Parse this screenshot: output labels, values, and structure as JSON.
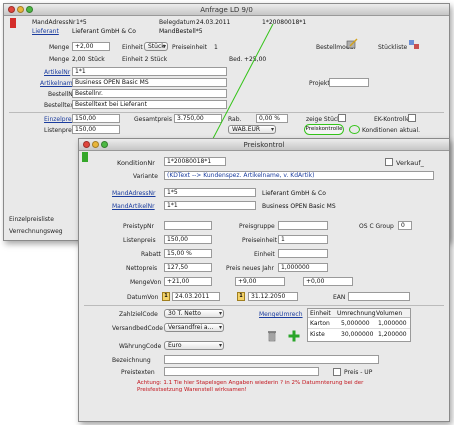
{
  "back": {
    "title": "Anfrage LD   9/0",
    "mandadresse_label": "MandAdressNr",
    "mandadresse_value": "1*5",
    "belegdatum_label": "Belegdatum",
    "belegdatum_value": "24.03.2011",
    "beleg_nr": "1*20080018*1",
    "lieferant_label": "Lieferant",
    "lieferant_value": "Lieferant GmbH & Co",
    "mandbestell": "MandBestell*5",
    "menge_label": "Menge",
    "menge_value": "+2,00",
    "einheit_label": "Einheit",
    "einheit_value": "Stück",
    "preiseinheit_label": "Preiseinheit",
    "preiseinheit_value": "1",
    "bestellmodul": "Bestellmodul",
    "stueckliste": "Stückliste",
    "menge2_label": "Menge",
    "menge2_value": "2,00",
    "menge2_unit": "Stück",
    "einheit2_label": "Einheit 2 Stück",
    "bedarf_label": "Bed.",
    "bedarf_value": "+25,00",
    "artikelnr_label": "ArtikelNr",
    "artikelnr_value": "1*1",
    "artikelname_label": "Artikelname",
    "artikelname_value": "Business OPEN Basic MS",
    "bestellnr_label": "BestellNr",
    "bestellnr_value": "Bestellnr.",
    "projekt_label": "Projekt",
    "bestelltext_label": "Bestelltext",
    "bestelltext_value": "Bestelltext bei Lieferant",
    "einzelpreis_label": "Einzelpreis",
    "einzelpreis_value": "150,00",
    "gesamtpreis_label": "Gesamtpreis",
    "gesamtpreis_value": "3.750,00",
    "rabatt_label": "Rab.",
    "rabatt_value": "0,00 %",
    "zeige_stueckliste": "zeige Stückl.",
    "ek_kontrolle": "EK-Kontrolle",
    "listenpreis_label": "Listenpreis",
    "listenpreis_value": "150,00",
    "waehrung_value": "WAB.EUR",
    "preiskontrolle_btn": "Preiskontrolle",
    "konditionen_btn": "Konditionen aktual.",
    "left1": "Einzelpreisliste",
    "left2": "Verrechnungsweg"
  },
  "front": {
    "title": "Preiskontrol",
    "konditionnr_label": "KonditionNr",
    "konditionnr_value": "1*20080018*1",
    "verkauf_label": "Verkauf_",
    "variante_label": "Variante",
    "variante_value": "(KDText --> Kundenspez. Artikelname, v. KdArtik)",
    "mandadressnr_label": "MandAdressNr",
    "mandadressnr_value": "1*5",
    "lieferant_value": "Lieferant GmbH & Co",
    "mandartikelnr_label": "MandArtikelNr",
    "mandartikelnr_value": "1*1",
    "artikel_value": "Business OPEN Basic MS",
    "preistypnr_label": "PreistypNr",
    "preisgruppe_label": "Preisgruppe",
    "osc_label": "OS C Group",
    "osc_value": "0",
    "listenpreis_label": "Listenpreis",
    "listenpreis_value": "150,00",
    "preiseinheit_label": "Preiseinheit",
    "preiseinheit_value": "1",
    "rabatt_label": "Rabatt",
    "rabatt_value": "15,00 %",
    "einheit_label": "Einheit",
    "nettopreis_label": "Nettopreis",
    "nettopreis_value": "127,50",
    "preis_neues_jahr_label": "Preis neues Jahr",
    "preis_neues_jahr_value": "1,000000",
    "mengevon_label": "MengeVon",
    "mengevon_value": "+21,00",
    "mengebis_value": "+9,00",
    "mengebis2_value": "+0,00",
    "datumvon_label": "DatumVon",
    "datumvon_value": "24.03.2011",
    "datumbis_value": "31.12.2050",
    "ean_label": "EAN",
    "zahlziel_label": "ZahlzielCode",
    "zahlziel_value": "30 T. Netto",
    "versand_label": "VersandbedCode",
    "versand_value": "Versandfrei a...",
    "waehrung_label": "WährungCode",
    "waehrung_value": "Euro",
    "mengeumrech_label": "MengeUmrech",
    "umrech_headers": [
      "Einheit",
      "Umrechnung",
      "Volumen"
    ],
    "umrech_rows": [
      [
        "Karton",
        "5,000000",
        "1,000000"
      ],
      [
        "Kiste",
        "30,000000",
        "1,200000"
      ]
    ],
    "bezeichnung_label": "Bezeichnung",
    "preistext_label": "Preistexten",
    "preis_up_label": "Preis - UP",
    "note": "Achtung: 1.1 Tie hier Stapelsgen Angaben wiederin ? in 2% Datumnterung bei der Preisfestsetzung Warenstell wirksamen!"
  },
  "accent": {
    "red": "#d42d2a",
    "blue": "#1a3c9e",
    "green": "#35c41a"
  }
}
